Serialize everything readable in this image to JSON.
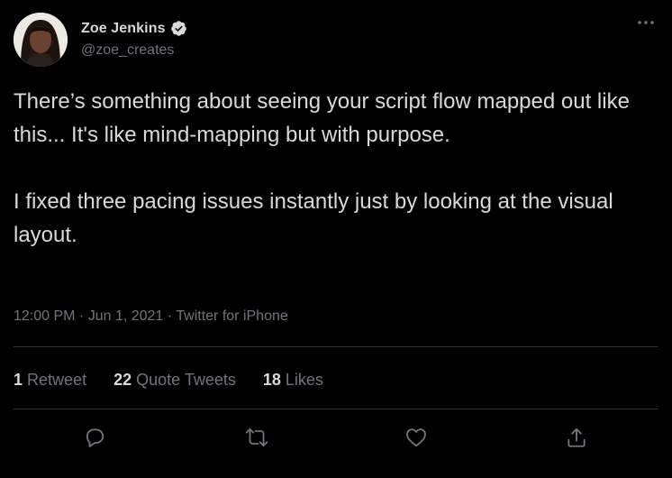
{
  "author": {
    "display_name": "Zoe Jenkins",
    "handle": "@zoe_creates",
    "verified": true
  },
  "tweet": {
    "text": "There’s something about seeing your script flow mapped out like this... It's like mind-mapping but with purpose.\n\nI fixed three pacing issues instantly just by looking at the visual layout.",
    "meta": "12:00 PM · Jun 1, 2021 · Twitter for iPhone"
  },
  "stats": {
    "retweets_count": "1",
    "retweets_label": "Retweet",
    "quotes_count": "22",
    "quotes_label": "Quote Tweets",
    "likes_count": "18",
    "likes_label": "Likes"
  },
  "icons": {
    "more": "more-options-icon",
    "verified": "verified-badge-icon",
    "reply": "reply-icon",
    "retweet": "retweet-icon",
    "like": "like-icon",
    "share": "share-icon"
  },
  "colors": {
    "background": "#000000",
    "text": "#d9d9d9",
    "secondary_text": "#6e767d",
    "divider": "#2f3336"
  }
}
